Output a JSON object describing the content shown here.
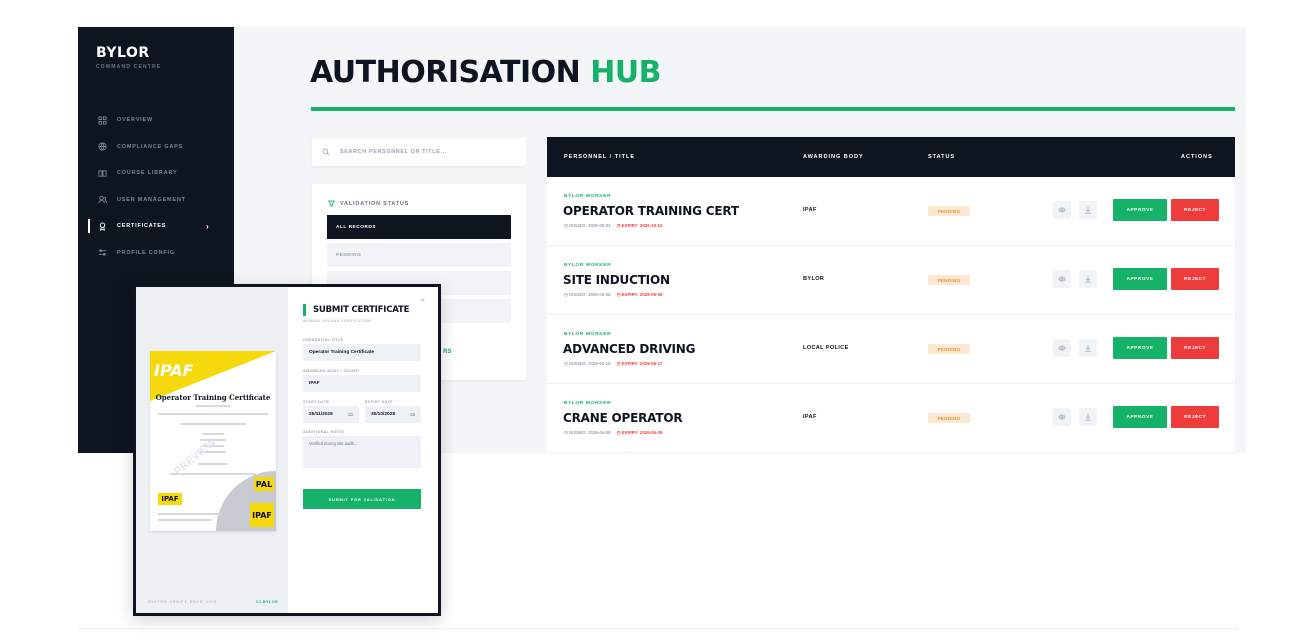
{
  "app": {
    "brand": "BYLOR",
    "brand_sub": "COMMAND CENTRE"
  },
  "sidebar": {
    "items": [
      {
        "label": "OVERVIEW",
        "icon": "grid-icon"
      },
      {
        "label": "COMPLIANCE GAPS",
        "icon": "globe-icon"
      },
      {
        "label": "COURSE LIBRARY",
        "icon": "book-icon"
      },
      {
        "label": "USER MANAGEMENT",
        "icon": "users-icon"
      },
      {
        "label": "CERTIFICATES",
        "icon": "certificate-icon",
        "active": true
      },
      {
        "label": "PROFILE CONFIG",
        "icon": "sliders-icon"
      }
    ]
  },
  "page": {
    "title_main": "AUTHORISATION",
    "title_accent": "HUB"
  },
  "search": {
    "placeholder": "SEARCH PERSONNEL OR TITLE..."
  },
  "filter": {
    "heading": "VALIDATION STATUS",
    "options": [
      "ALL RECORDS",
      "PENDING"
    ]
  },
  "table": {
    "headers": {
      "personnel": "PERSONNEL / TITLE",
      "body": "AWARDING BODY",
      "status": "STATUS",
      "actions": "ACTIONS"
    },
    "rows": [
      {
        "kicker": "BYLOR WORKER",
        "name": "OPERATOR TRAINING CERT",
        "issued": "ISSUED: 2026-05-01",
        "expiry": "EXPIRY: 2026-10-10",
        "body": "IPAF",
        "status": "PENDING"
      },
      {
        "kicker": "BYLOR WORKER",
        "name": "SITE INDUCTION",
        "issued": "ISSUED: 2026-04-08",
        "expiry": "EXPIRY: 2026-05-05",
        "body": "BYLOR",
        "status": "PENDING"
      },
      {
        "kicker": "BYLOR WORKER",
        "name": "ADVANCED DRIVING",
        "issued": "ISSUED: 2026-04-15",
        "expiry": "EXPIRY: 2026-06-17",
        "body": "LOCAL POLICE",
        "status": "PENDING"
      },
      {
        "kicker": "BYLOR WORKER",
        "name": "CRANE OPERATOR",
        "issued": "ISSUED: 2026-04-08",
        "expiry": "EXPIRY: 2026-06-09",
        "body": "IPAF",
        "status": "PENDING"
      }
    ],
    "approve_label": "APPROVE",
    "reject_label": "REJECT"
  },
  "modal": {
    "title": "SUBMIT CERTIFICATE",
    "subtitle": "MANUAL UPLOAD VERIFICATION",
    "fields": {
      "credential_label": "CREDENTIAL TITLE",
      "credential_value": "Operator Training Certificate",
      "body_label": "AWARDING BODY / ISSUER",
      "body_value": "IPAF",
      "start_label": "START DATE",
      "start_value": "25/11/2026",
      "expiry_label": "EXPIRY DATE",
      "expiry_value": "30/10/2028",
      "notes_label": "ADDITIONAL NOTES",
      "notes_value": "Verified during site audit..."
    },
    "submit_label": "SUBMIT FOR VALIDATION",
    "footer_left": "SYSTEM_VERIFY_ENCR_2026",
    "footer_right": "V1.BYLOR",
    "cert": {
      "logo": "IPAF",
      "title": "Operator Training Certificate",
      "stamp1": "PAL",
      "stamp2": "IPAF",
      "stamp3": "IPAF"
    }
  },
  "peek_text": "RS",
  "colors": {
    "accent": "#17b26a",
    "dark": "#0e1420",
    "danger": "#ee3b3b",
    "pending_bg": "#fde8d3"
  }
}
